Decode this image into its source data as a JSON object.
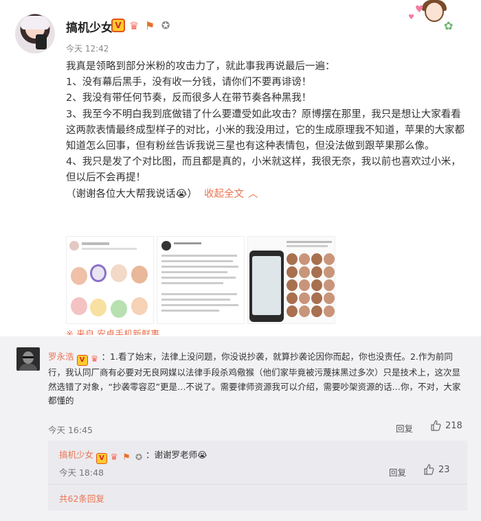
{
  "post": {
    "username": "搞机少女",
    "time": "今天 12:42",
    "paragraphs": [
      "我真是领略到部分米粉的攻击力了，就此事我再说最后一遍：",
      "1、没有幕后黑手，没有收一分钱，请你们不要再诽谤！",
      "2、我没有带任何节奏，反而很多人在带节奏各种黑我！",
      "3、我至今不明白我到底做错了什么要遭受如此攻击？原博摆在那里，我只是想让大家看看这两款表情最终成型样子的对比，小米的我没用过，它的生成原理我不知道，苹果的大家都知道怎么回事，但有粉丝告诉我说三星也有这种表情包，但没法做到跟苹果那么像。",
      "4、我只是发了个对比图，而且都是真的，小米就这样，我很无奈，我以前也喜欢过小米，但以后不会再提！"
    ],
    "closing": "（谢谢各位大大帮我说话😭）",
    "collapse_label": "收起全文",
    "source_text": "※ 来自 安卓手机新鲜事"
  },
  "comment": {
    "name": "罗永浩",
    "text": "：1.看了始末，法律上没问题，你没说抄袭，就算抄袭论因你而起，你也没责任。2.作为前同行，我认同厂商有必要对无良网媒以法律手段杀鸡儆猴（他们家毕竟被污蔑抹黑过多次）只是技术上，这次显然选错了对象，“抄袭零容忍”更是…不说了。需要律师资源我可以介绍，需要吵架资源的话…你，不对，大家都懂的",
    "time": "今天 16:45",
    "reply_label": "回复",
    "likes": "218"
  },
  "sub_reply": {
    "name": "搞机少女",
    "text": "：谢谢罗老师😭",
    "time": "今天 18:48",
    "reply_label": "回复",
    "likes": "23"
  },
  "total_replies": "共62条回复",
  "colors": {
    "accent": "#eb7350",
    "comment_bg": "#f2f2f5"
  }
}
